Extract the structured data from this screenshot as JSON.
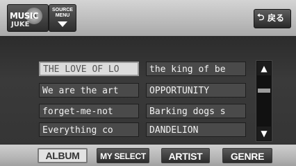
{
  "header": {
    "logo_line1": "MUSIC",
    "logo_line2": "JUKE",
    "source_menu_line1": "SOURCE",
    "source_menu_line2": "MENU",
    "back_arrow": "⮌",
    "back_label": "戻る"
  },
  "list": {
    "items_left": [
      "THE LOVE OF LO",
      "We are the art",
      "forget-me-not",
      "Everything co"
    ],
    "items_right": [
      "the king of be",
      "OPPORTUNITY",
      "Barking dogs s",
      "DANDELION"
    ],
    "selected_item": "THE LOVE OF LO"
  },
  "scrollbar": {
    "up_glyph": "▲",
    "down_glyph": "▼"
  },
  "tabs": {
    "album": "ALBUM",
    "my_select": "MY SELECT",
    "artist": "ARTIST",
    "genre": "GENRE",
    "active": "ALBUM"
  }
}
